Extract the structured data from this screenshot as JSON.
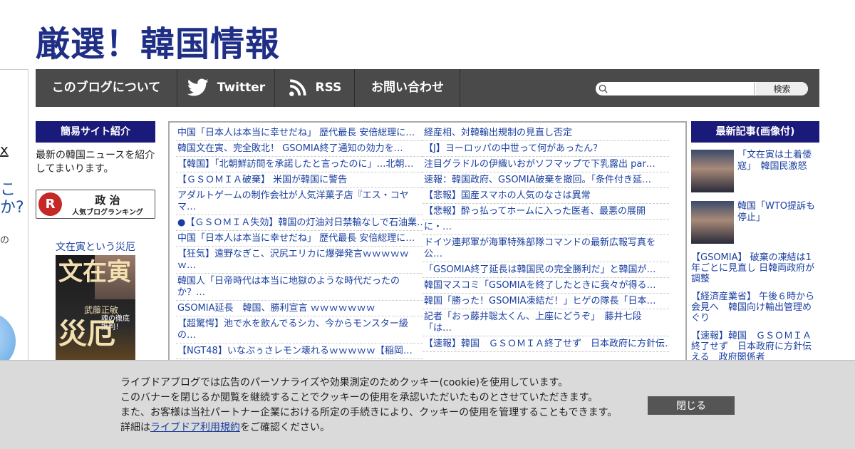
{
  "site": {
    "title": "厳選！韓国情報"
  },
  "side_strip": {
    "t1": "x",
    "t2": "こ",
    "t3": "か?",
    "t4": "の"
  },
  "nav": {
    "about": "このブログについて",
    "twitter": "Twitter",
    "rss": "RSS",
    "contact": "お問い合わせ",
    "search_placeholder": "",
    "search_button": "検索"
  },
  "left": {
    "header": "簡易サイト紹介",
    "intro": "最新の韓国ニュースを紹介してまいります。",
    "ranking": {
      "logo": "R",
      "line1": "政 治",
      "line2": "人気ブログランキング"
    },
    "book": {
      "title": "文在寅という災厄",
      "cover_t1": "文在寅",
      "cover_t2": "災厄",
      "cover_author": "武藤正敏",
      "cover_sub": "魂の徹底批判！"
    }
  },
  "center": {
    "col1": [
      "中国「日本人は本当に幸せだね」 歴代最長 安倍総理に…",
      "韓国文在寅、完全敗北！ GSOMIA終了通知の効力を…",
      "【韓国】「北朝鮮訪問を承諾したと言ったのに」…北朝…",
      "【ＧＳＯＭＩＡ破棄】 米国が韓国に警告",
      "アダルトゲームの制作会社が人気洋菓子店『エス・コヤマ…",
      "●【ＧＳＯＭＩＡ失効】韓国の灯油対日禁輸なしで石油業…",
      "中国「日本人は本当に幸せだね」 歴代最長 安倍総理に…",
      "【狂気】遠野なぎこ、沢尻エリカに爆弾発言ｗｗｗｗｗｗ…",
      "韓国人「日帝時代は本当に地獄のような時代だったのか？…",
      "GSOMIA延長　韓国、勝利宣言 ｗｗｗｗｗｗｗ",
      "【超驚愕】池で水を飲んでるシカ、今からモンスター級の…",
      "【NGT48】いなぷぅさレモン壊れるｗｗｗｗｗ【稲岡…"
    ],
    "col2": [
      "経産相、対韓輸出規制の見直し否定",
      "【J】ヨーロッパの中世って何があったん？",
      "注目グラドルの伊織いおがソフマップで下乳露出 par…",
      "速報：韓国政府、GSOMIA破棄を撤回。「条件付き延…",
      "【悲報】国産スマホの人気のなさは異常",
      "【悲報】酔っ払ってホームに入った医者、最悪の展開",
      "に・…",
      "ドイツ連邦軍が海軍特殊部隊コマンドの最新広報写真を公…",
      "「GSOMIA終了延長は韓国民の完全勝利だ」と韓国が…",
      "韓国マスコミ「GSOMIAを終了したときに我々が得る…",
      "韓国「勝った！GSOMIA凍結だ！」ヒゲの隊長「日本…",
      "記者「おっ藤井聡太くん、上座にどうぞ」　藤井七段「は…",
      "【速報】韓国　ＧＳＯＭＩＡ終了せず　日本政府に方針伝…"
    ]
  },
  "right": {
    "header": "最新記事(画像付)",
    "thumbs": [
      "「文在寅は土着倭寇」　韓国民激怒",
      "韓国「WTO提訴も停止」"
    ],
    "links": [
      "【GSOMIA】 破棄の凍結は1年ごとに見直し 日韓両政府が調整",
      "【経済産業省】 午後６時から会見へ　韓国向け輸出管理めぐり",
      "【速報】韓国　ＧＳＯＭＩＡ終了せず　日本政府に方針伝える　政府関係者"
    ]
  },
  "cookie": {
    "line1": "ライブドアブログでは広告のパーソナライズや効果測定のためクッキー(cookie)を使用しています。",
    "line2": "このバナーを閉じるか閲覧を継続することでクッキーの使用を承認いただいたものとさせていただきます。",
    "line3": "また、お客様は当社パートナー企業における所定の手続きにより、クッキーの使用を管理することもできます。",
    "line4_pre": "詳細は",
    "line4_link": "ライブドア利用規約",
    "line4_post": "をご確認ください。",
    "close": "閉じる"
  },
  "colors": {
    "nav_bg": "#4a4a4a",
    "header_bg": "#1a1a7a",
    "link": "#1a3fa0",
    "title": "#1f2f86"
  }
}
